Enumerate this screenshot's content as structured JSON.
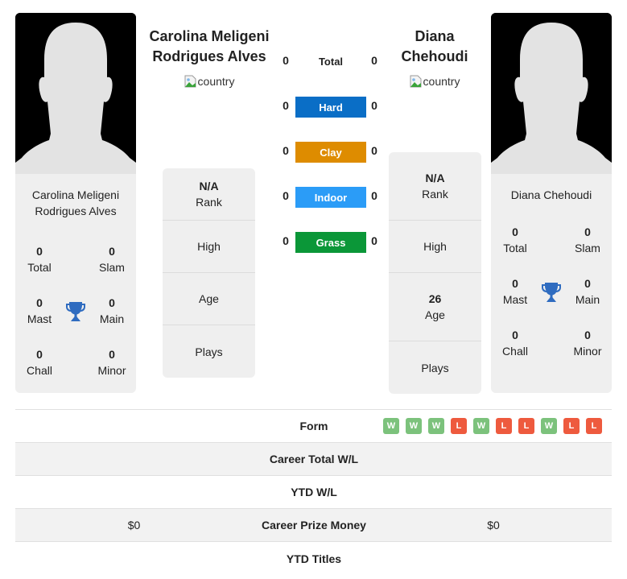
{
  "player1": {
    "name": "Carolina Meligeni Rodrigues Alves",
    "name_line1": "Carolina Meligeni",
    "name_line2": "Rodrigues Alves",
    "flag_alt": "country",
    "stats": {
      "total": {
        "value": "0",
        "label": "Total"
      },
      "slam": {
        "value": "0",
        "label": "Slam"
      },
      "mast": {
        "value": "0",
        "label": "Mast"
      },
      "main": {
        "value": "0",
        "label": "Main"
      },
      "chall": {
        "value": "0",
        "label": "Chall"
      },
      "minor": {
        "value": "0",
        "label": "Minor"
      }
    },
    "info": {
      "rank": {
        "value": "N/A",
        "label": "Rank"
      },
      "high": {
        "value": "",
        "label": "High"
      },
      "age": {
        "value": "",
        "label": "Age"
      },
      "plays": {
        "value": "",
        "label": "Plays"
      }
    }
  },
  "player2": {
    "name": "Diana Chehoudi",
    "name_line1": "Diana",
    "name_line2": "Chehoudi",
    "flag_alt": "country",
    "stats": {
      "total": {
        "value": "0",
        "label": "Total"
      },
      "slam": {
        "value": "0",
        "label": "Slam"
      },
      "mast": {
        "value": "0",
        "label": "Mast"
      },
      "main": {
        "value": "0",
        "label": "Main"
      },
      "chall": {
        "value": "0",
        "label": "Chall"
      },
      "minor": {
        "value": "0",
        "label": "Minor"
      }
    },
    "info": {
      "rank": {
        "value": "N/A",
        "label": "Rank"
      },
      "high": {
        "value": "",
        "label": "High"
      },
      "age": {
        "value": "26",
        "label": "Age"
      },
      "plays": {
        "value": "",
        "label": "Plays"
      }
    }
  },
  "surfaces": [
    {
      "label": "Total",
      "p1": "0",
      "p2": "0",
      "color": ""
    },
    {
      "label": "Hard",
      "p1": "0",
      "p2": "0",
      "color": "#0a6ec6"
    },
    {
      "label": "Clay",
      "p1": "0",
      "p2": "0",
      "color": "#de8c00"
    },
    {
      "label": "Indoor",
      "p1": "0",
      "p2": "0",
      "color": "#2b9cf7"
    },
    {
      "label": "Grass",
      "p1": "0",
      "p2": "0",
      "color": "#0b9738"
    }
  ],
  "table": {
    "rows": [
      {
        "label": "Form",
        "p1": "",
        "p2": ""
      },
      {
        "label": "Career Total W/L",
        "p1": "",
        "p2": ""
      },
      {
        "label": "YTD W/L",
        "p1": "",
        "p2": ""
      },
      {
        "label": "Career Prize Money",
        "p1": "$0",
        "p2": "$0"
      },
      {
        "label": "YTD Titles",
        "p1": "",
        "p2": ""
      }
    ],
    "p2_form": [
      "W",
      "W",
      "W",
      "L",
      "W",
      "L",
      "L",
      "W",
      "L",
      "L"
    ]
  },
  "colors": {
    "win": "#7cc27c",
    "loss": "#ee5a3e",
    "trophy": "#2f6cc0"
  }
}
